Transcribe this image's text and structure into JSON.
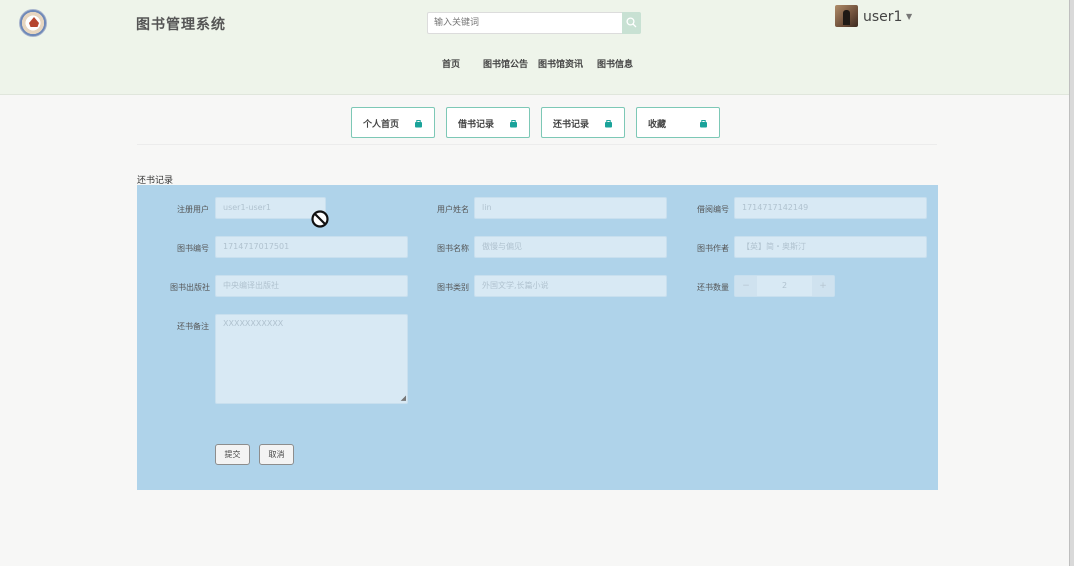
{
  "header": {
    "site_title": "图书管理系统",
    "search_placeholder": "输入关键词",
    "username": "user1"
  },
  "nav": {
    "items": [
      {
        "label": "首页"
      },
      {
        "label": "图书馆公告"
      },
      {
        "label": "图书馆资讯"
      },
      {
        "label": "图书信息"
      }
    ]
  },
  "tabs": [
    {
      "label": "个人首页"
    },
    {
      "label": "借书记录"
    },
    {
      "label": "还书记录"
    },
    {
      "label": "收藏"
    }
  ],
  "form": {
    "title": "还书记录",
    "fields": {
      "register_user": {
        "label": "注册用户",
        "value": "user1-user1"
      },
      "user_name": {
        "label": "用户姓名",
        "value": "lin"
      },
      "borrow_no": {
        "label": "借阅编号",
        "value": "1714717142149"
      },
      "book_no": {
        "label": "图书编号",
        "value": "1714717017501"
      },
      "book_name": {
        "label": "图书名称",
        "value": "傲慢与偏见"
      },
      "book_author": {
        "label": "图书作者",
        "value": "【英】简・奥斯汀"
      },
      "publisher": {
        "label": "图书出版社",
        "value": "中央编译出版社"
      },
      "category": {
        "label": "图书类别",
        "value": "外国文学,长篇小说"
      },
      "return_qty": {
        "label": "还书数量",
        "value": "2",
        "minus": "−",
        "plus": "+"
      },
      "remark": {
        "label": "还书备注",
        "value": "XXXXXXXXXXX"
      }
    },
    "submit_label": "提交",
    "cancel_label": "取消"
  },
  "colors": {
    "header_bg": "#eef4ea",
    "panel_bg": "#afd3ea",
    "tab_border": "#7dc8b6",
    "accent": "#1aa39a"
  }
}
